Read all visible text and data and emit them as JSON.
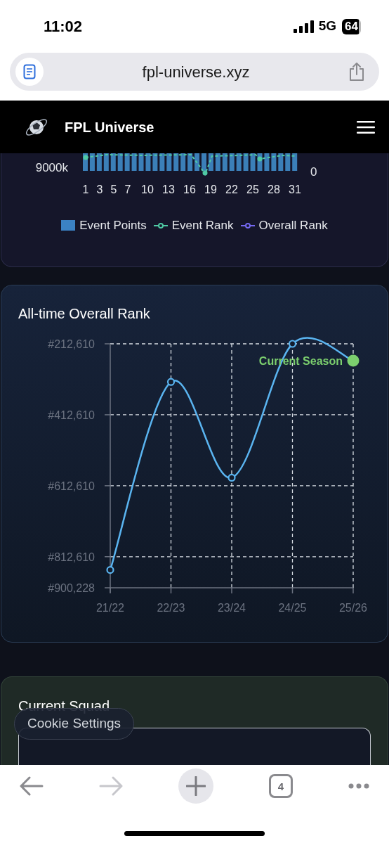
{
  "status_bar": {
    "time": "11:02",
    "network": "5G",
    "battery": "64"
  },
  "address_bar": {
    "url": "fpl-universe.xyz"
  },
  "navbar": {
    "title": "FPL Universe"
  },
  "gameweek_chart": {
    "y_label": "9000k",
    "y2_label": "0",
    "x_labels": [
      "1",
      "3",
      "5",
      "7",
      "10",
      "13",
      "16",
      "19",
      "22",
      "25",
      "28",
      "31"
    ],
    "legend": [
      {
        "label": "Event Points",
        "kind": "bar",
        "color": "#3b82c4"
      },
      {
        "label": "Event Rank",
        "kind": "line",
        "color": "#4fc9a4"
      },
      {
        "label": "Overall Rank",
        "kind": "line",
        "color": "#7468f0"
      }
    ]
  },
  "rank_card": {
    "title": "All-time Overall Rank",
    "chart_data": {
      "type": "line",
      "categories": [
        "21/22",
        "22/23",
        "23/24",
        "24/25",
        "25/26"
      ],
      "series": [
        {
          "color": "#5ab4f0",
          "marker": "circle",
          "values": [
            850000,
            320000,
            590000,
            212610,
            260000
          ]
        }
      ],
      "grid": true,
      "ylim": [
        900228,
        212610
      ],
      "yticks": [
        {
          "value": 212610,
          "label": "#212,610"
        },
        {
          "value": 412610,
          "label": "#412,610"
        },
        {
          "value": 612610,
          "label": "#612,610"
        },
        {
          "value": 812610,
          "label": "#812,610"
        },
        {
          "value": 900228,
          "label": "#900,228"
        }
      ],
      "annotations": [
        {
          "x": "25/26",
          "text": "Current Season"
        }
      ]
    }
  },
  "squad_card": {
    "title": "Current Squad"
  },
  "cookie_button": {
    "label": "Cookie Settings"
  },
  "toolbar": {
    "tabs_count": "4",
    "forward_disabled": true
  }
}
